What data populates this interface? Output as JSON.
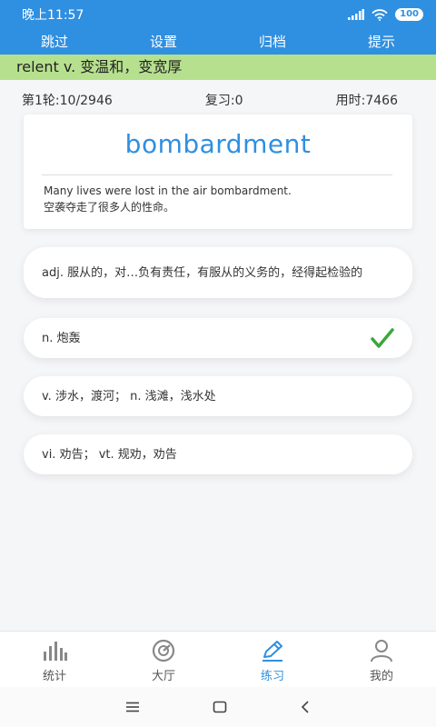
{
  "status_bar": {
    "time": "晚上11:57",
    "battery": "100"
  },
  "top_nav": {
    "skip": "跳过",
    "settings": "设置",
    "archive": "归档",
    "hint": "提示"
  },
  "review_banner": "relent  v. 变温和，变宽厚",
  "stats": {
    "round": "第1轮:10/2946",
    "review": "复习:0",
    "time_used": "用时:7466"
  },
  "word": {
    "headword": "bombardment",
    "example_en": "Many lives were lost in the air bombardment.",
    "example_zh": "空袭夺走了很多人的性命。"
  },
  "options": [
    {
      "text": "adj. 服从的，对…负有责任，有服从的义务的，经得起检验的",
      "correct": false
    },
    {
      "text": "n. 炮轰",
      "correct": true
    },
    {
      "text": "v. 涉水，渡河；  n. 浅滩，浅水处",
      "correct": false
    },
    {
      "text": "vi. 劝告；  vt. 规劝，劝告",
      "correct": false
    }
  ],
  "bottom_nav": {
    "stats": "统计",
    "hall": "大厅",
    "practice": "练习",
    "mine": "我的",
    "active": "practice"
  },
  "colors": {
    "primary": "#2f8fe0",
    "banner": "#b6e08e",
    "check": "#3aa83a"
  },
  "icons": [
    "signal-icon",
    "wifi-icon",
    "battery-icon",
    "check-icon",
    "bar-chart-icon",
    "gauge-icon",
    "pencil-icon",
    "user-icon",
    "menu-icon",
    "home-square-icon",
    "back-icon"
  ]
}
